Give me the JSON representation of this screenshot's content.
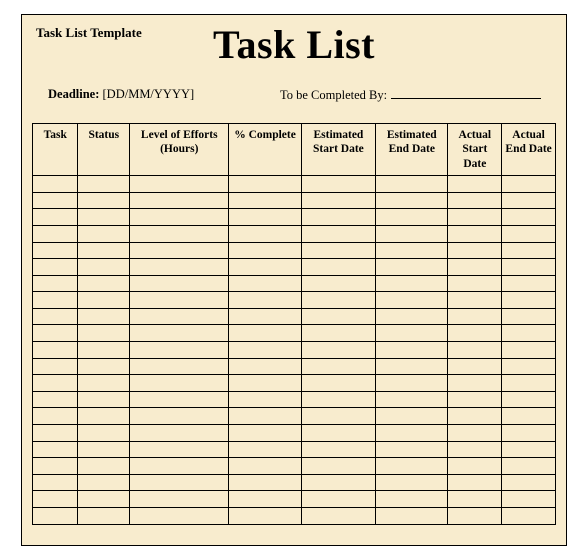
{
  "template_label": "Task List Template",
  "title": "Task List",
  "meta": {
    "deadline_label": "Deadline:",
    "deadline_value": "[DD/MM/YYYY]",
    "completed_by_label": "To be Completed By:"
  },
  "columns": [
    "Task",
    "Status",
    "Level of Efforts (Hours)",
    "% Complete",
    "Estimated Start Date",
    "Estimated End Date",
    "Actual Start Date",
    "Actual End Date"
  ],
  "row_count": 21
}
